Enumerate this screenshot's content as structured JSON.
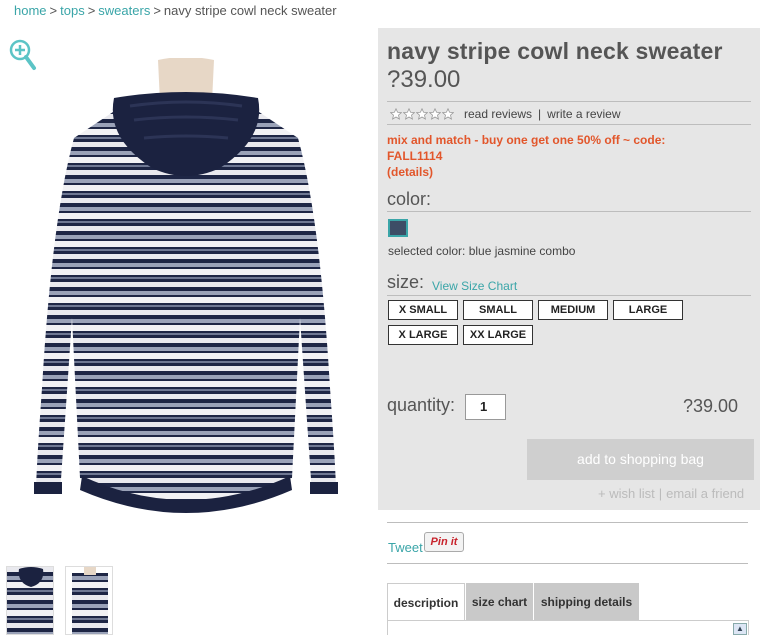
{
  "breadcrumb": {
    "items": [
      "home",
      "tops",
      "sweaters"
    ],
    "current": "navy stripe cowl neck sweater",
    "separator": ">"
  },
  "product": {
    "title": "navy stripe cowl neck sweater",
    "price": "?39.00",
    "rating_stars": 0,
    "read_reviews": "read reviews",
    "write_review": "write a review",
    "promo_line1": "mix and match - buy one get one 50% off ~ code:",
    "promo_line2": "FALL1114",
    "promo_details": "(details)"
  },
  "color": {
    "label": "color:",
    "selected_text": "selected color: blue jasmine combo",
    "swatch_color": "#3d4d66"
  },
  "size": {
    "label": "size:",
    "chart_link": "View Size Chart",
    "options": [
      "X SMALL",
      "SMALL",
      "MEDIUM",
      "LARGE",
      "X LARGE",
      "XX LARGE"
    ]
  },
  "quantity": {
    "label": "quantity:",
    "value": "1",
    "total": "?39.00"
  },
  "actions": {
    "add_to_bag": "add to shopping bag",
    "wish_list": "+ wish list",
    "email_friend": "email a friend"
  },
  "social": {
    "tweet": "Tweet",
    "pin_it": "Pin it"
  },
  "tabs": [
    "description",
    "size chart",
    "shipping details"
  ],
  "colors": {
    "accent": "#3aa5a8",
    "promo": "#e2562b",
    "panel": "#e6e6e6",
    "navy": "#1e2645"
  }
}
